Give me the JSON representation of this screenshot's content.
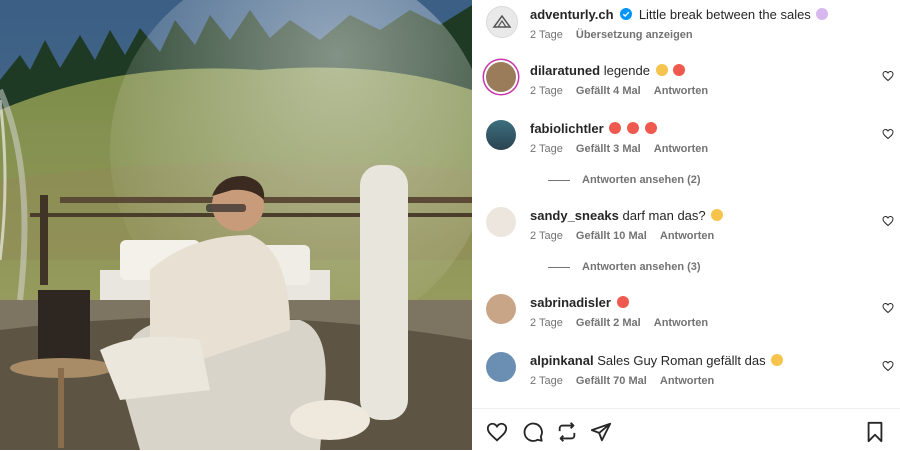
{
  "caption": {
    "user": "adventurly.ch",
    "text": "Little break between the sales",
    "time": "2 Tage",
    "translate": "Übersetzung anzeigen"
  },
  "comments": [
    {
      "user": "dilaratuned",
      "text": "legende",
      "time": "2 Tage",
      "likes": "Gefällt 4 Mal",
      "reply": "Antworten"
    },
    {
      "user": "fabiolichtler",
      "text": "",
      "time": "2 Tage",
      "likes": "Gefällt 3 Mal",
      "reply": "Antworten",
      "view_replies": "Antworten ansehen (2)"
    },
    {
      "user": "sandy_sneaks",
      "text": "darf man das?",
      "time": "2 Tage",
      "likes": "Gefällt 10 Mal",
      "reply": "Antworten",
      "view_replies": "Antworten ansehen (3)"
    },
    {
      "user": "sabrinadisler",
      "text": "",
      "time": "2 Tage",
      "likes": "Gefällt 2 Mal",
      "reply": "Antworten"
    },
    {
      "user": "alpinkanal",
      "text": "Sales Guy Roman gefällt das",
      "time": "2 Tage",
      "likes": "Gefällt 70 Mal",
      "reply": "Antworten"
    }
  ],
  "icons": {
    "like": "heart-icon",
    "comment": "comment-icon",
    "share": "share-icon",
    "repost": "repost-icon",
    "save": "bookmark-icon",
    "verified": "verified-badge-icon"
  },
  "colors": {
    "verified": "#0095f6",
    "text": "#262626",
    "muted": "#737373"
  }
}
